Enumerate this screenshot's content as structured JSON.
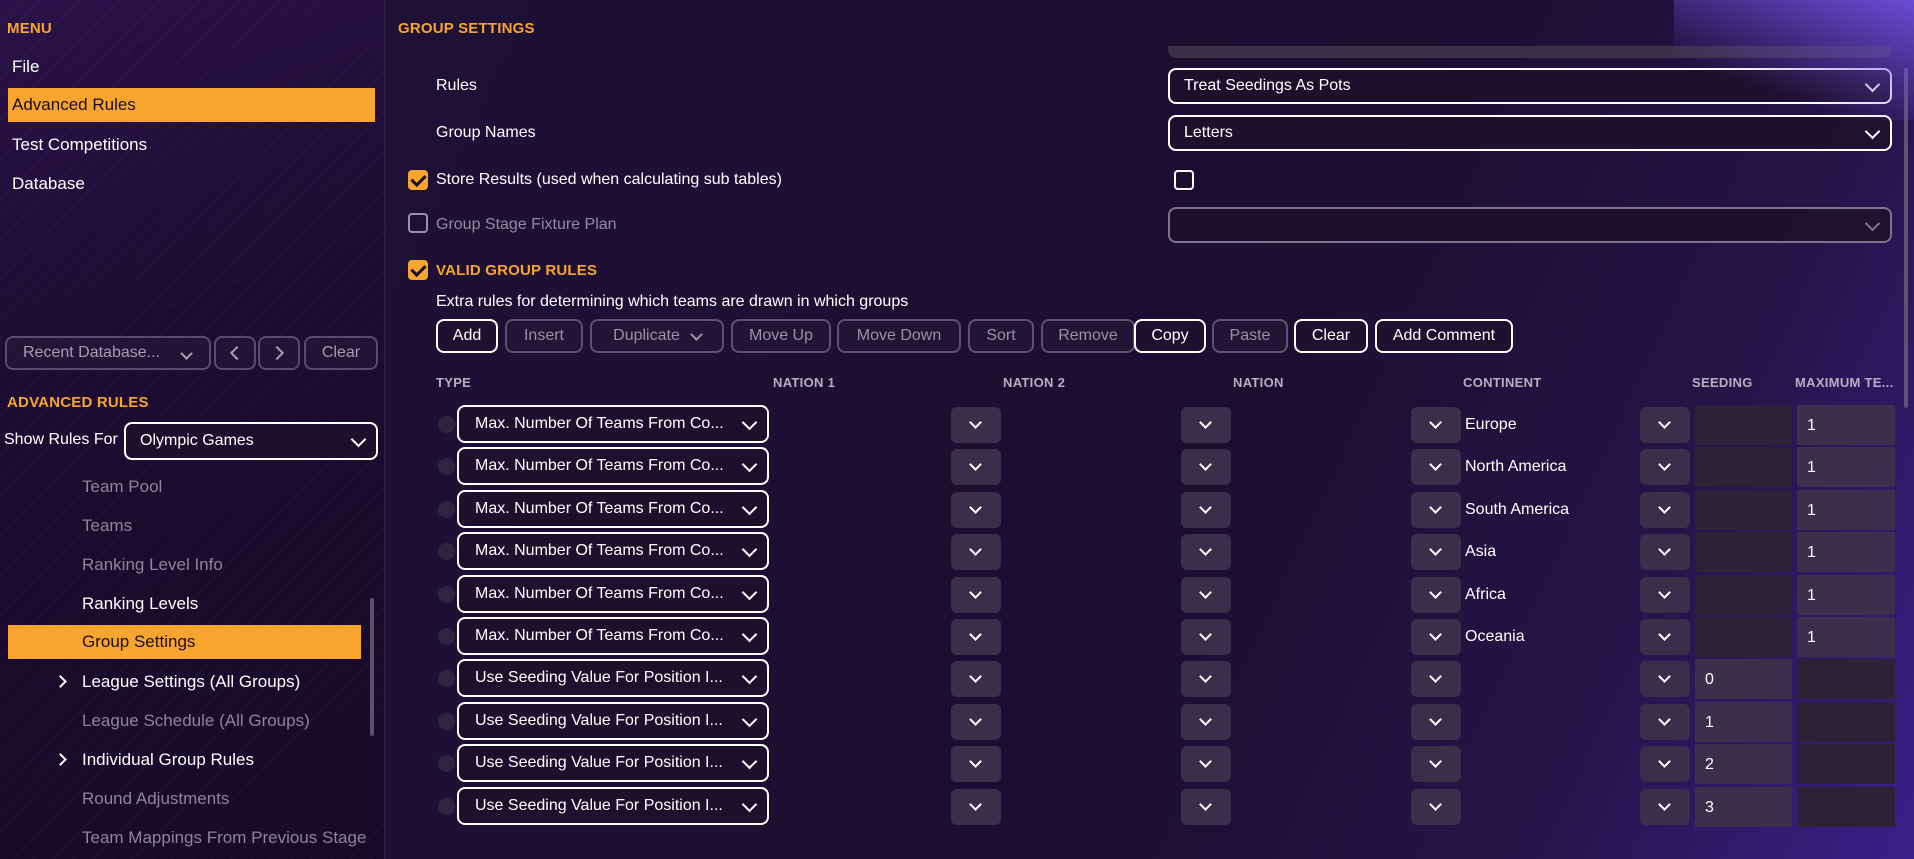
{
  "sidebar": {
    "menu_title": "MENU",
    "menu_items": [
      {
        "label": "File"
      },
      {
        "label": "Advanced Rules"
      },
      {
        "label": "Test Competitions"
      },
      {
        "label": "Database"
      }
    ],
    "recent_db_label": "Recent Database...",
    "clear_label": "Clear",
    "advanced_rules_title": "ADVANCED RULES",
    "show_rules_for_label": "Show Rules For",
    "show_rules_for_value": "Olympic Games",
    "tree_items": [
      {
        "label": "Team Pool"
      },
      {
        "label": "Teams"
      },
      {
        "label": "Ranking Level Info"
      },
      {
        "label": "Ranking Levels"
      },
      {
        "label": "Group Settings"
      },
      {
        "label": "League Settings (All Groups)"
      },
      {
        "label": "League Schedule (All Groups)"
      },
      {
        "label": "Individual Group Rules"
      },
      {
        "label": "Round Adjustments"
      },
      {
        "label": "Team Mappings From Previous Stage"
      }
    ]
  },
  "main": {
    "title": "GROUP SETTINGS",
    "rules_label": "Rules",
    "rules_value": "Treat Seedings As Pots",
    "group_names_label": "Group Names",
    "group_names_value": "Letters",
    "store_results_label": "Store Results (used when calculating sub tables)",
    "fixture_plan_label": "Group Stage Fixture Plan",
    "fixture_plan_value": "",
    "valid_rules_title": "VALID GROUP RULES",
    "valid_rules_desc": "Extra rules for determining which teams are drawn in which groups",
    "toolbar": {
      "add": "Add",
      "insert": "Insert",
      "duplicate": "Duplicate",
      "move_up": "Move Up",
      "move_down": "Move Down",
      "sort": "Sort",
      "remove": "Remove",
      "copy": "Copy",
      "paste": "Paste",
      "clear": "Clear",
      "add_comment": "Add Comment"
    },
    "columns": {
      "type": "TYPE",
      "nation1": "NATION 1",
      "nation2": "NATION 2",
      "nation": "NATION",
      "continent": "CONTINENT",
      "seeding": "SEEDING",
      "max_teams": "MAXIMUM TE..."
    },
    "rows": [
      {
        "type": "Max. Number Of Teams From Co...",
        "continent": "Europe",
        "seeding": "",
        "max": "1"
      },
      {
        "type": "Max. Number Of Teams From Co...",
        "continent": "North America",
        "seeding": "",
        "max": "1"
      },
      {
        "type": "Max. Number Of Teams From Co...",
        "continent": "South America",
        "seeding": "",
        "max": "1"
      },
      {
        "type": "Max. Number Of Teams From Co...",
        "continent": "Asia",
        "seeding": "",
        "max": "1"
      },
      {
        "type": "Max. Number Of Teams From Co...",
        "continent": "Africa",
        "seeding": "",
        "max": "1"
      },
      {
        "type": "Max. Number Of Teams From Co...",
        "continent": "Oceania",
        "seeding": "",
        "max": "1"
      },
      {
        "type": "Use Seeding Value For Position I...",
        "continent": "",
        "seeding": "0",
        "max": ""
      },
      {
        "type": "Use Seeding Value For Position I...",
        "continent": "",
        "seeding": "1",
        "max": ""
      },
      {
        "type": "Use Seeding Value For Position I...",
        "continent": "",
        "seeding": "2",
        "max": ""
      },
      {
        "type": "Use Seeding Value For Position I...",
        "continent": "",
        "seeding": "3",
        "max": ""
      }
    ]
  }
}
